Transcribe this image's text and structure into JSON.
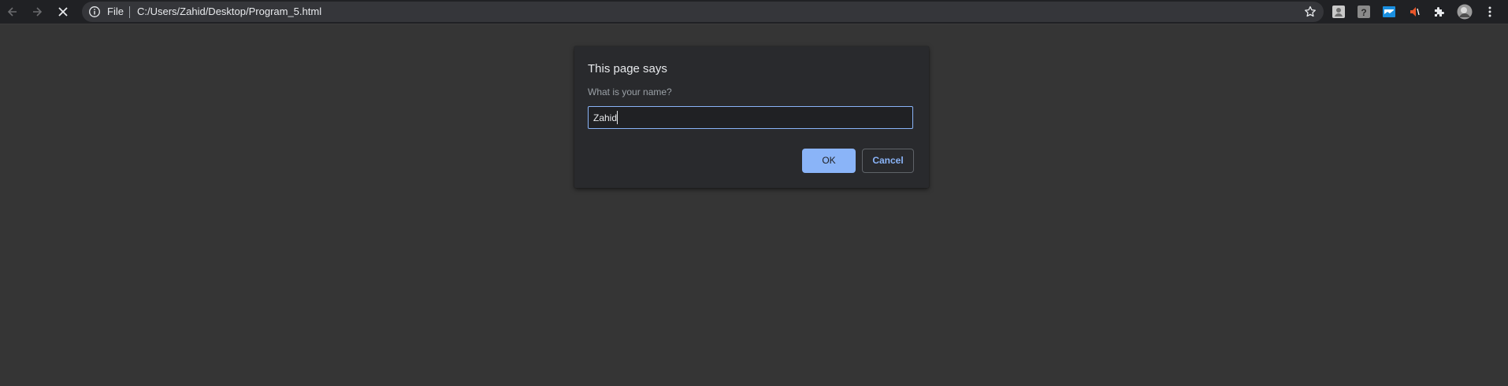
{
  "browser": {
    "omnibox": {
      "scheme_label": "File",
      "url": "C:/Users/Zahid/Desktop/Program_5.html"
    },
    "icons": {
      "back": "back-arrow-icon",
      "forward": "forward-arrow-icon",
      "stop": "stop-loading-icon",
      "info": "site-info-icon",
      "bookmark": "bookmark-star-icon",
      "extensions": [
        "extension-puzzle-icon"
      ],
      "menu": "kebab-menu-icon"
    }
  },
  "dialog": {
    "title": "This page says",
    "message": "What is your name?",
    "input_value": "Zahid",
    "ok_label": "OK",
    "cancel_label": "Cancel"
  },
  "colors": {
    "page_background": "#353535",
    "toolbar_background": "#202124",
    "dialog_background": "#292a2d",
    "accent": "#8ab4f8"
  }
}
